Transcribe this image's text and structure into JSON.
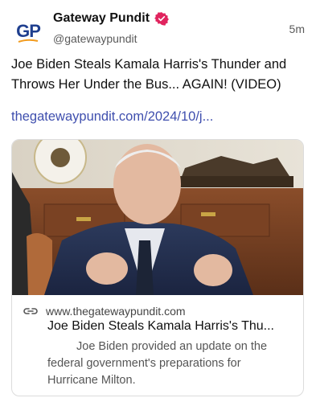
{
  "account": {
    "display_name": "Gateway Pundit",
    "handle": "@gatewaypundit",
    "avatar_text": "GP",
    "verified_icon": "verified-badge-icon",
    "verified_color": "#e0245e"
  },
  "post": {
    "timestamp": "5m",
    "text": "Joe Biden Steals Kamala Harris's Thunder and Throws Her Under the Bus... AGAIN! (VIDEO)",
    "link": "thegatewaypundit.com/2024/10/j..."
  },
  "card": {
    "domain": "www.thegatewaypundit.com",
    "title": "Joe Biden Steals Kamala Harris's Thu...",
    "description": "Joe Biden provided an update on the federal government's preparations for Hurricane Milton.",
    "link_icon": "link-icon"
  },
  "colors": {
    "link": "#3f4fae",
    "brand_blue": "#1f3f8f",
    "brand_orange": "#f29b1d"
  }
}
